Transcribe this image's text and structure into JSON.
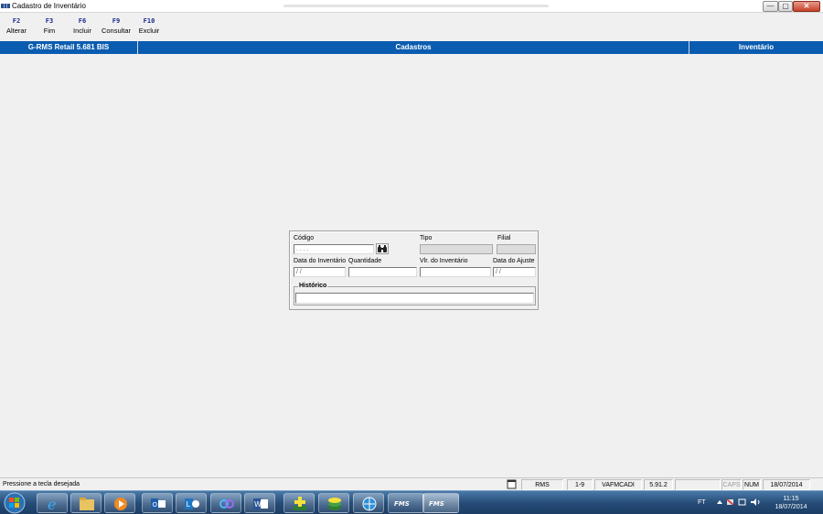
{
  "window": {
    "title": "Cadastro de Inventário",
    "controls": {
      "minimize": "—",
      "maximize": "▢",
      "close": "✕"
    }
  },
  "toolbar": {
    "keys": [
      {
        "key": "F2",
        "label": "Alterar"
      },
      {
        "key": "F3",
        "label": "Fim"
      },
      {
        "key": "F6",
        "label": "Incluir"
      },
      {
        "key": "F9",
        "label": "Consultar"
      },
      {
        "key": "F10",
        "label": "Excluir"
      }
    ]
  },
  "header": {
    "product": "G-RMS Retail 5.681 BIS",
    "module": "Cadastros",
    "screen": "Inventário"
  },
  "form": {
    "codigo_label": "Código",
    "codigo_value": ". . . .",
    "tipo_label": "Tipo",
    "filial_label": "Filial",
    "data_inventario_label": "Data do Inventário",
    "data_inventario_value": "/ /",
    "quantidade_label": "Quantidade",
    "vlr_inventario_label": "Vlr. do Inventário",
    "data_ajuste_label": "Data do Ajuste",
    "data_ajuste_value": "/ /",
    "historico_label": "Histórico",
    "search_icon": "binoculars-icon"
  },
  "statusbar": {
    "message": "Pressione a tecla desejada",
    "cells": [
      "RMS",
      "1-9",
      "VAFMCADI",
      "5.91.2",
      "",
      "CAPS",
      "NUM",
      "18/07/2014"
    ]
  },
  "taskbar": {
    "fms1": "FMS",
    "fms2": "FMS",
    "lang": "FT",
    "time": "11:15",
    "date": "18/07/2014",
    "colors": {
      "taskbar": "#244a75",
      "header": "#0a5cb0"
    }
  }
}
